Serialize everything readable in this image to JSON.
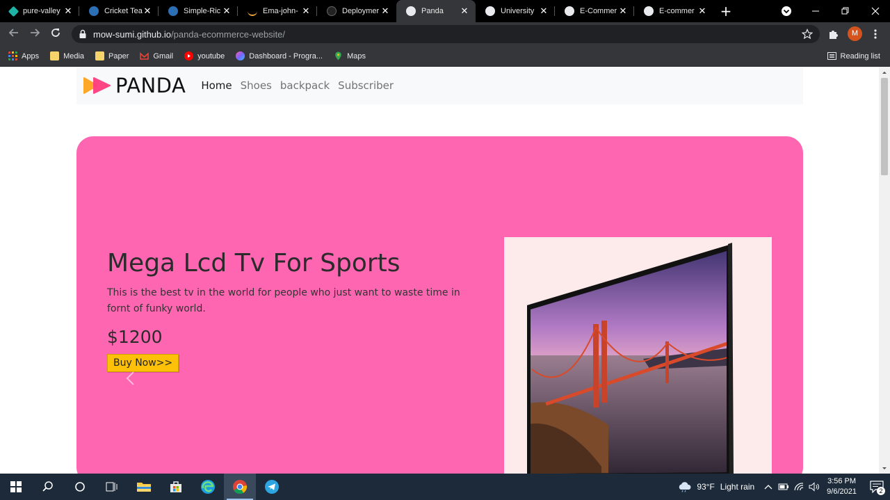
{
  "browser": {
    "tabs": [
      {
        "label": "pure-valley",
        "favicon_color": "#1fb3a6",
        "active": false
      },
      {
        "label": "Cricket Tea",
        "favicon_color": "#5a9be6",
        "active": false
      },
      {
        "label": "Simple-Ric",
        "favicon_color": "#5a9be6",
        "active": false
      },
      {
        "label": "Ema-john-",
        "favicon_color": "#e6a23c",
        "active": false
      },
      {
        "label": "Deploymer",
        "favicon_color": "#444444",
        "active": false
      },
      {
        "label": "Panda",
        "favicon_color": "#e8eaed",
        "active": true
      },
      {
        "label": "University",
        "favicon_color": "#e8eaed",
        "active": false
      },
      {
        "label": "E-Commer",
        "favicon_color": "#e8eaed",
        "active": false
      },
      {
        "label": "E-commer",
        "favicon_color": "#e8eaed",
        "active": false
      }
    ],
    "new_tab_label": "+",
    "close_glyph": "✕",
    "url_host": "mow-sumi.github.io",
    "url_path": "/panda-ecommerce-website/",
    "profile_initial": "M",
    "bookmarks": [
      {
        "label": "Apps",
        "icon": "apps-grid-icon",
        "color": "#f4b400"
      },
      {
        "label": "Media",
        "icon": "folder-icon",
        "color": "#f6d36b"
      },
      {
        "label": "Paper",
        "icon": "folder-icon",
        "color": "#f6d36b"
      },
      {
        "label": "Gmail",
        "icon": "gmail-icon",
        "color": "#ea4335"
      },
      {
        "label": "youtube",
        "icon": "youtube-icon",
        "color": "#ff0000"
      },
      {
        "label": "Dashboard - Progra...",
        "icon": "dashboard-icon",
        "color": "#b36bff"
      },
      {
        "label": "Maps",
        "icon": "maps-icon",
        "color": "#34a853"
      }
    ],
    "reading_list_label": "Reading list"
  },
  "site": {
    "brand": "PANDA",
    "nav": [
      {
        "label": "Home",
        "active": true
      },
      {
        "label": "Shoes",
        "active": false
      },
      {
        "label": "backpack",
        "active": false
      },
      {
        "label": "Subscriber",
        "active": false
      }
    ],
    "hero": {
      "title": "Mega Lcd Tv For Sports",
      "description": "This is the best tv in the world for people who just want to waste time in fornt of funky world.",
      "price": "$1200",
      "button_label": "Buy Now>>",
      "background": "#ff66b2"
    }
  },
  "taskbar": {
    "weather_temp": "93°F",
    "weather_desc": "Light rain",
    "time": "3:56 PM",
    "date": "9/6/2021",
    "notification_count": "2"
  }
}
